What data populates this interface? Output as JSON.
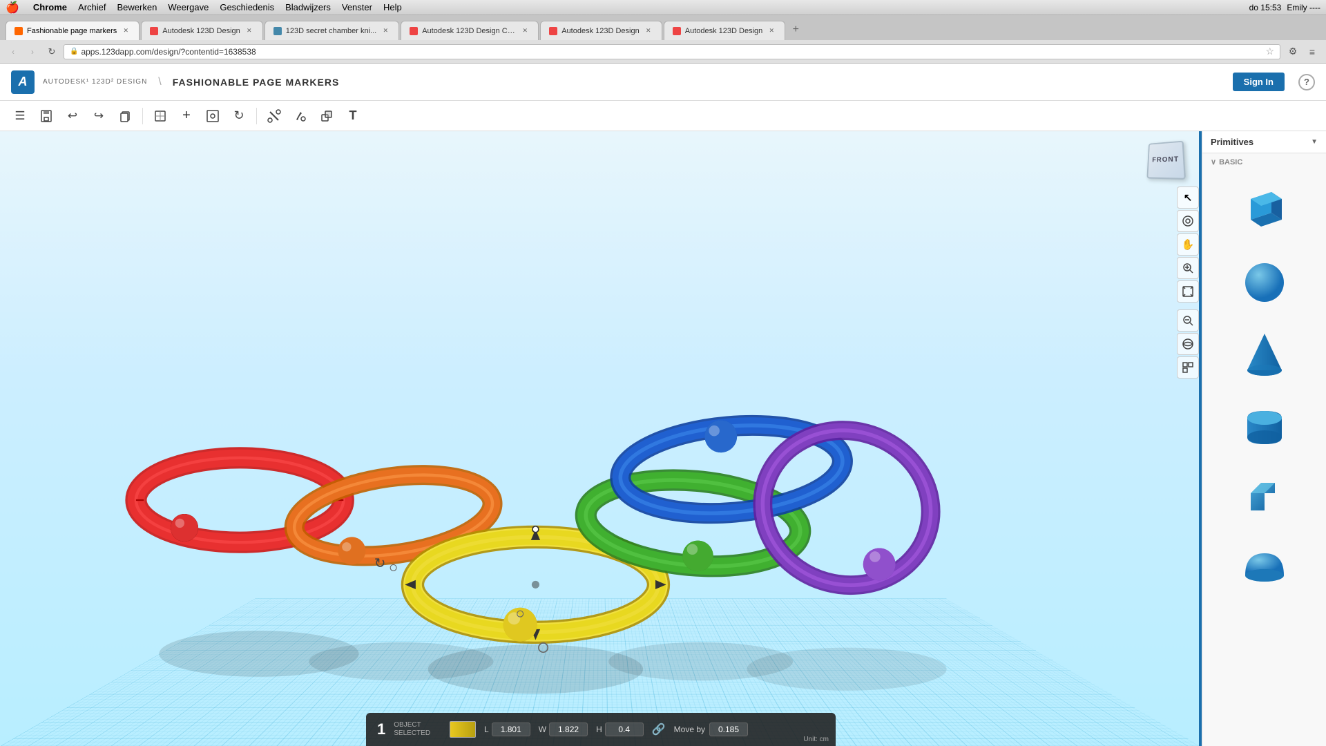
{
  "macMenubar": {
    "appName": "Chrome",
    "menus": [
      "Archief",
      "Bewerken",
      "Weergave",
      "Geschiedenis",
      "Bladwijzers",
      "Venster",
      "Help"
    ],
    "rightItems": [
      "do 15:53",
      "Emily ----"
    ]
  },
  "browser": {
    "tabs": [
      {
        "label": "Fashionable page markers",
        "active": true,
        "favicon": "orange"
      },
      {
        "label": "Autodesk 123D Design",
        "active": false,
        "favicon": "autodesk"
      },
      {
        "label": "123D secret chamber kni...",
        "active": false,
        "favicon": "secret"
      },
      {
        "label": "Autodesk 123D Design Ch...",
        "active": false,
        "favicon": "autodesk"
      },
      {
        "label": "Autodesk 123D Design",
        "active": false,
        "favicon": "autodesk"
      },
      {
        "label": "Autodesk 123D Design",
        "active": false,
        "favicon": "autodesk"
      }
    ],
    "addressBar": {
      "url": "apps.123dapp.com/design/?contentid=1638538",
      "protocol": "https"
    }
  },
  "app": {
    "logoLetter": "A",
    "titleTop": "AUTODESK¹ 123D² DESIGN",
    "breadcrumb": "FASHIONABLE PAGE MARKERS",
    "signInLabel": "Sign In",
    "helpLabel": "?"
  },
  "toolbar": {
    "buttons": [
      {
        "name": "menu-button",
        "icon": "☰"
      },
      {
        "name": "save-button",
        "icon": "💾"
      },
      {
        "name": "undo-button",
        "icon": "↩"
      },
      {
        "name": "redo-button",
        "icon": "↪"
      },
      {
        "name": "duplicate-button",
        "icon": "❐"
      },
      {
        "name": "sketch-button",
        "icon": "⬚"
      },
      {
        "name": "add-button",
        "icon": "+"
      },
      {
        "name": "transform-button",
        "icon": "⊡"
      },
      {
        "name": "refresh-button",
        "icon": "↻"
      },
      {
        "name": "cut-button",
        "icon": "✂"
      },
      {
        "name": "paint-button",
        "icon": "🎨"
      },
      {
        "name": "combine-button",
        "icon": "⬡"
      },
      {
        "name": "text-button",
        "icon": "T"
      }
    ]
  },
  "viewCube": {
    "label": "FRONT"
  },
  "rightToolbar": {
    "tools": [
      {
        "name": "select-tool",
        "icon": "↖"
      },
      {
        "name": "orbit-tool",
        "icon": "◎"
      },
      {
        "name": "pan-tool",
        "icon": "✋"
      },
      {
        "name": "zoom-tool",
        "icon": "🔍"
      },
      {
        "name": "fit-tool",
        "icon": "⊞"
      },
      {
        "name": "zoom-in-tool",
        "icon": "⊕"
      },
      {
        "name": "camera-tool",
        "icon": "👁"
      },
      {
        "name": "grid-tool",
        "icon": "⊠"
      }
    ]
  },
  "primitives": {
    "title": "Primitives",
    "section": "Basic",
    "shapes": [
      {
        "name": "box",
        "label": "Box"
      },
      {
        "name": "sphere",
        "label": "Sphere"
      },
      {
        "name": "cone",
        "label": "Cone"
      },
      {
        "name": "cylinder",
        "label": "Cylinder"
      },
      {
        "name": "bracket",
        "label": "Bracket"
      },
      {
        "name": "hemisphere",
        "label": "Hemisphere"
      }
    ]
  },
  "statusBar": {
    "count": "1",
    "objectLabel": "OBJECT",
    "selectedLabel": "SELECTED",
    "lLabel": "L",
    "lValue": "1.801",
    "wLabel": "W",
    "wValue": "1.822",
    "hLabel": "H",
    "hValue": "0.4",
    "moveByLabel": "Move by",
    "moveByValue": "0.185",
    "unitLabel": "Unit: cm"
  }
}
